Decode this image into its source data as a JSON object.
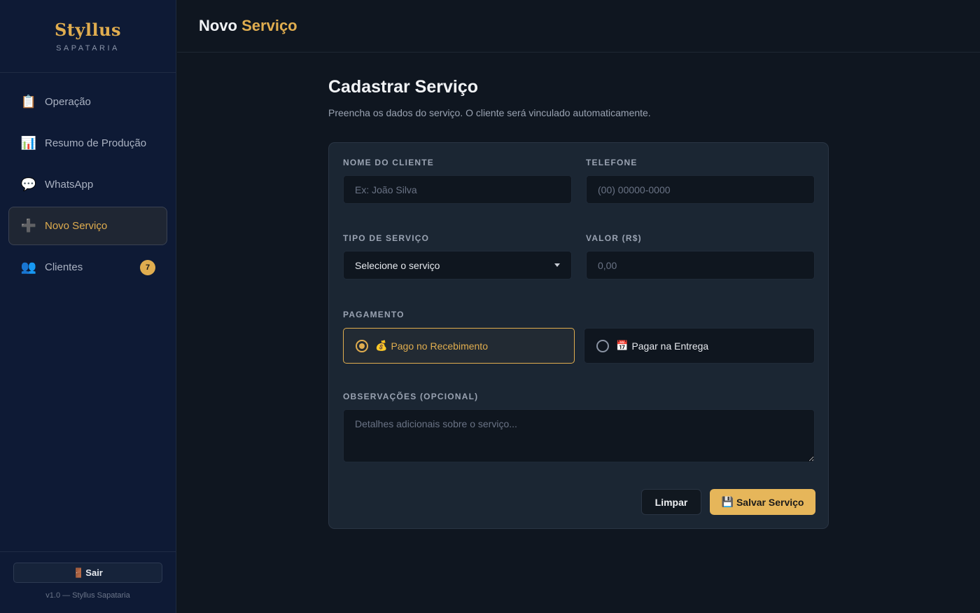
{
  "brand": {
    "name": "Styllus",
    "subtitle": "SAPATARIA"
  },
  "sidebar": {
    "items": [
      {
        "icon": "clipboard-icon",
        "glyph": "📋",
        "label": "Operação"
      },
      {
        "icon": "bar-chart-icon",
        "glyph": "📊",
        "label": "Resumo de Produção"
      },
      {
        "icon": "speech-bubble-icon",
        "glyph": "💬",
        "label": "WhatsApp"
      },
      {
        "icon": "plus-icon",
        "glyph": "➕",
        "label": "Novo Serviço",
        "active": true
      },
      {
        "icon": "users-icon",
        "glyph": "👥",
        "label": "Clientes",
        "badge": "7"
      }
    ],
    "logout": {
      "icon": "door-icon",
      "glyph": "🚪",
      "label": "Sair"
    },
    "version": "v1.0 — Styllus Sapataria"
  },
  "header": {
    "title_main": "Novo",
    "title_accent": "Serviço"
  },
  "main": {
    "title": "Cadastrar Serviço",
    "description": "Preencha os dados do serviço. O cliente será vinculado automaticamente."
  },
  "form": {
    "client_name": {
      "label": "NOME DO CLIENTE",
      "placeholder": "Ex: João Silva",
      "value": ""
    },
    "phone": {
      "label": "TELEFONE",
      "placeholder": "(00) 00000-0000",
      "value": ""
    },
    "service_type": {
      "label": "TIPO DE SERVIÇO",
      "selected": "Selecione o serviço"
    },
    "price": {
      "label": "VALOR (R$)",
      "placeholder": "0,00",
      "value": ""
    },
    "payment": {
      "label": "PAGAMENTO",
      "options": [
        {
          "icon": "money-bag-icon",
          "glyph": "💰",
          "label": "Pago no Recebimento",
          "selected": true
        },
        {
          "icon": "calendar-icon",
          "glyph": "📅",
          "label": "Pagar na Entrega",
          "selected": false
        }
      ]
    },
    "notes": {
      "label": "OBSERVAÇÕES (OPCIONAL)",
      "placeholder": "Detalhes adicionais sobre o serviço...",
      "value": ""
    },
    "actions": {
      "clear_label": "Limpar",
      "save_glyph": "💾",
      "save_label": "Salvar Serviço"
    }
  },
  "colors": {
    "accent": "#e0ad4f",
    "sidebar_bg": "#0e1a35",
    "page_bg": "#0f1620",
    "card_bg": "#1b2633"
  }
}
